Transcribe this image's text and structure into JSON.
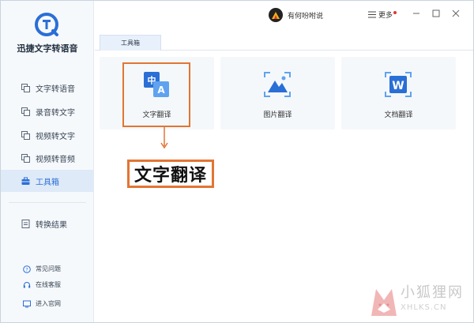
{
  "app": {
    "name": "迅捷文字转语音"
  },
  "sidebar": {
    "items": [
      {
        "label": "文字转语音",
        "icon": "text-to-speech-icon"
      },
      {
        "label": "录音转文字",
        "icon": "recording-to-text-icon"
      },
      {
        "label": "视频转文字",
        "icon": "video-to-text-icon"
      },
      {
        "label": "视频转音频",
        "icon": "video-to-audio-icon"
      },
      {
        "label": "工具箱",
        "icon": "toolbox-icon",
        "active": true
      },
      {
        "label": "转换结果",
        "icon": "result-icon"
      }
    ],
    "bottom": [
      {
        "label": "常见问题",
        "icon": "question-icon"
      },
      {
        "label": "在线客服",
        "icon": "headset-icon"
      },
      {
        "label": "进入官网",
        "icon": "website-icon"
      }
    ]
  },
  "header": {
    "user_name": "有何吩咐说",
    "more_label": "更多"
  },
  "tabs": [
    {
      "label": "工具箱"
    }
  ],
  "tools": [
    {
      "label": "文字翻译",
      "icon": "text-translate-icon"
    },
    {
      "label": "图片翻译",
      "icon": "image-translate-icon"
    },
    {
      "label": "文档翻译",
      "icon": "document-translate-icon"
    }
  ],
  "callout": {
    "label": "文字翻译"
  },
  "watermark": {
    "cn": "小狐狸网",
    "en": "XHLKS.CN"
  },
  "colors": {
    "accent": "#2a6fd6",
    "highlight": "#e27533",
    "sidebar_bg": "#f6f9fc"
  }
}
